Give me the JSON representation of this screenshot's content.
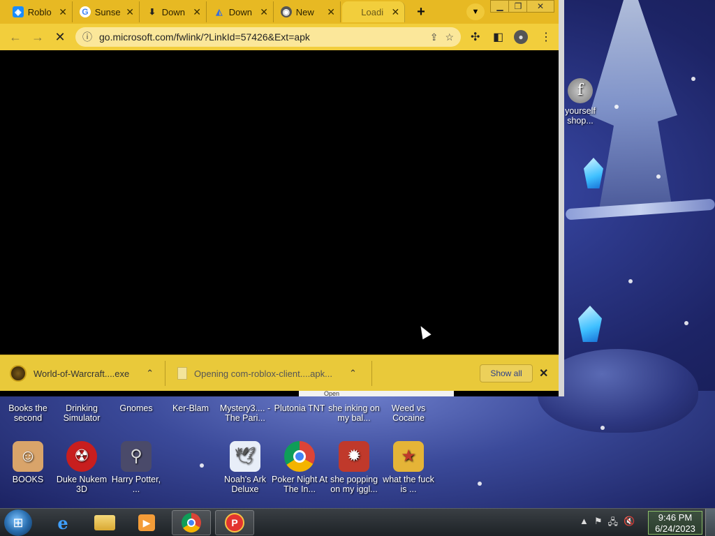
{
  "browser": {
    "tabs": [
      {
        "title": "Roblo",
        "icon": "roblox-icon",
        "active": false
      },
      {
        "title": "Sunse",
        "icon": "google-icon",
        "active": false
      },
      {
        "title": "Down",
        "icon": "download-icon",
        "active": false
      },
      {
        "title": "Down",
        "icon": "drive-icon",
        "active": false
      },
      {
        "title": "New",
        "icon": "chrome-icon",
        "active": false
      },
      {
        "title": "Loadi",
        "icon": "loading-icon",
        "active": true
      }
    ],
    "new_tab_label": "+",
    "url": "go.microsoft.com/fwlink/?LinkId=57426&Ext=apk",
    "downloads": [
      {
        "name": "World-of-Warcraft....exe",
        "icon": "wow-icon"
      },
      {
        "name": "Opening com-roblox-client....apk...",
        "icon": "file-icon"
      }
    ],
    "show_all_label": "Show all"
  },
  "desktop": {
    "right_icon_label": "yourself shop...",
    "row1": [
      {
        "label": "Books the second"
      },
      {
        "label": "Drinking Simulator"
      },
      {
        "label": "Gnomes"
      },
      {
        "label": "Ker-Blam"
      },
      {
        "label": "Mystery3.... - The Pari..."
      },
      {
        "label": "Plutonia TNT"
      },
      {
        "label": "she inking on my bal..."
      },
      {
        "label": "Weed vs Cocaine"
      }
    ],
    "row2": [
      {
        "label": "BOOKS",
        "icon": "books-icon",
        "color": "#d9a46a"
      },
      {
        "label": "Duke Nukem 3D",
        "icon": "radiation-icon",
        "color": "#c81e1e"
      },
      {
        "label": "Harry Potter, ...",
        "icon": "wizard-icon",
        "color": "#4a4a6a"
      },
      {
        "label": "Noah's Ark Deluxe",
        "icon": "dove-icon",
        "color": "#e8eef8"
      },
      {
        "label": "Poker Night At The In...",
        "icon": "chrome-icon",
        "color": "#2f9d46"
      },
      {
        "label": "she popping on my iggl...",
        "icon": "creature-icon",
        "color": "#c0392b"
      },
      {
        "label": "what the fuck is ...",
        "icon": "star-icon",
        "color": "#e5b437"
      }
    ],
    "partial_label": "Open"
  },
  "taskbar": {
    "time": "9:46 PM",
    "date": "6/24/2023"
  }
}
